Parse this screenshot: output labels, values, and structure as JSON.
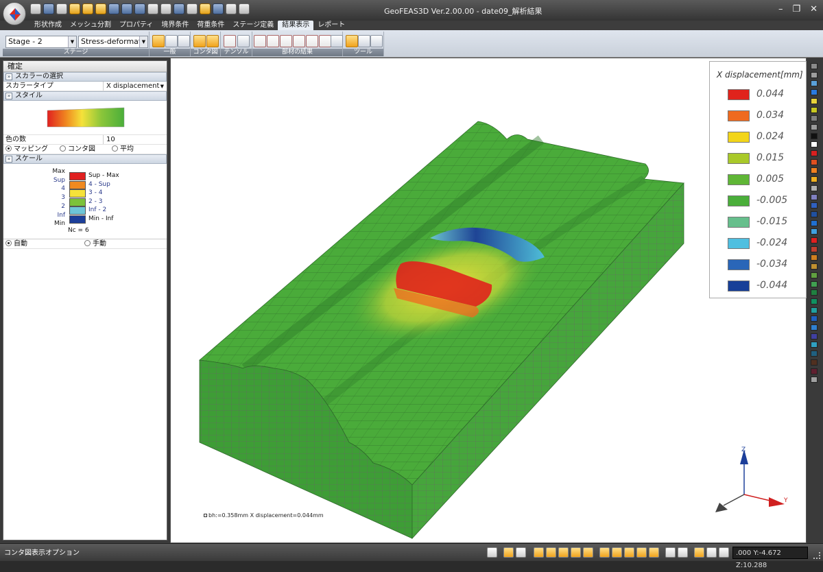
{
  "window": {
    "title": "GeoFEAS3D Ver.2.00.00 - date09_解析結果",
    "controls": {
      "minimize": "–",
      "restore": "❐",
      "close": "✕"
    }
  },
  "menu": {
    "tabs": [
      "形状作成",
      "メッシュ分割",
      "プロパティ",
      "境界条件",
      "荷重条件",
      "ステージ定義",
      "結果表示",
      "レポート"
    ],
    "active": "結果表示"
  },
  "ribbon": {
    "stage_combo": "Stage - 2",
    "result_combo": "Stress-deformatio",
    "groups": {
      "stage": "ステージ",
      "general": "一般",
      "contour": "コンタ図",
      "tensor": "テンソル",
      "member": "部材の結果",
      "tool": "ツール"
    }
  },
  "panel": {
    "header": "確定",
    "scalar_section": "スカラーの選択",
    "scalar_type_label": "スカラータイプ",
    "scalar_type_value": "X displacement",
    "style_section": "スタイル",
    "color_count_label": "色の数",
    "color_count_value": "10",
    "mode_mapping": "マッピング",
    "mode_contour": "コンタ図",
    "mode_average": "平均",
    "scale_section": "スケール",
    "scale": {
      "left_labels": [
        "Max",
        "Sup",
        "4",
        "3",
        "2",
        "Inf",
        "Min"
      ],
      "bands": [
        "Sup - Max",
        "4 - Sup",
        "3 - 4",
        "2 - 3",
        "Inf - 2",
        "Min - Inf"
      ],
      "band_colors": [
        "#e02020",
        "#f08a20",
        "#f5e23a",
        "#7cc23a",
        "#6ec6d8",
        "#1c3f9a"
      ],
      "nc": "Nc = 6"
    },
    "auto_label": "自動",
    "manual_label": "手動"
  },
  "legend": {
    "title": "X displacement[mm]",
    "items": [
      {
        "value": "0.044",
        "color": "#e0231c"
      },
      {
        "value": "0.034",
        "color": "#ef6a1f"
      },
      {
        "value": "0.024",
        "color": "#f2d51a"
      },
      {
        "value": "0.015",
        "color": "#a9c92a"
      },
      {
        "value": "0.005",
        "color": "#5fb636"
      },
      {
        "value": "-0.005",
        "color": "#4aae3a"
      },
      {
        "value": "-0.015",
        "color": "#66bf8c"
      },
      {
        "value": "-0.024",
        "color": "#4fbfe0"
      },
      {
        "value": "-0.034",
        "color": "#2a66b8"
      },
      {
        "value": "-0.044",
        "color": "#173f98"
      }
    ]
  },
  "viewport": {
    "readout": "bh:=0.358mm  X displacement=0.044mm",
    "axes": {
      "z": "Z",
      "y": "Y"
    }
  },
  "status": {
    "text": "コンタ図表示オプション",
    "coord": ".000 Y:-4.672 Z:10.288"
  },
  "palette_colors": [
    "#8a8a8a",
    "#9e9e9e",
    "#5aa0d8",
    "#2a7ae0",
    "#e8d23a",
    "#c8c820",
    "#808080",
    "#9a9a9a",
    "#111111",
    "#ffffff",
    "#d82020",
    "#e05020",
    "#f08020",
    "#f0b020",
    "#b0b0b0",
    "#8080c0",
    "#3060c0",
    "#2050a0",
    "#2070d0",
    "#40a0e0",
    "#e02020",
    "#c04030",
    "#d08020",
    "#c09030",
    "#60a040",
    "#40a050",
    "#208040",
    "#109060",
    "#20a0a0",
    "#2060c0",
    "#3080d0",
    "#4040a0",
    "#30a0c0",
    "#206080",
    "#503020",
    "#602030",
    "#a0a0a0"
  ]
}
